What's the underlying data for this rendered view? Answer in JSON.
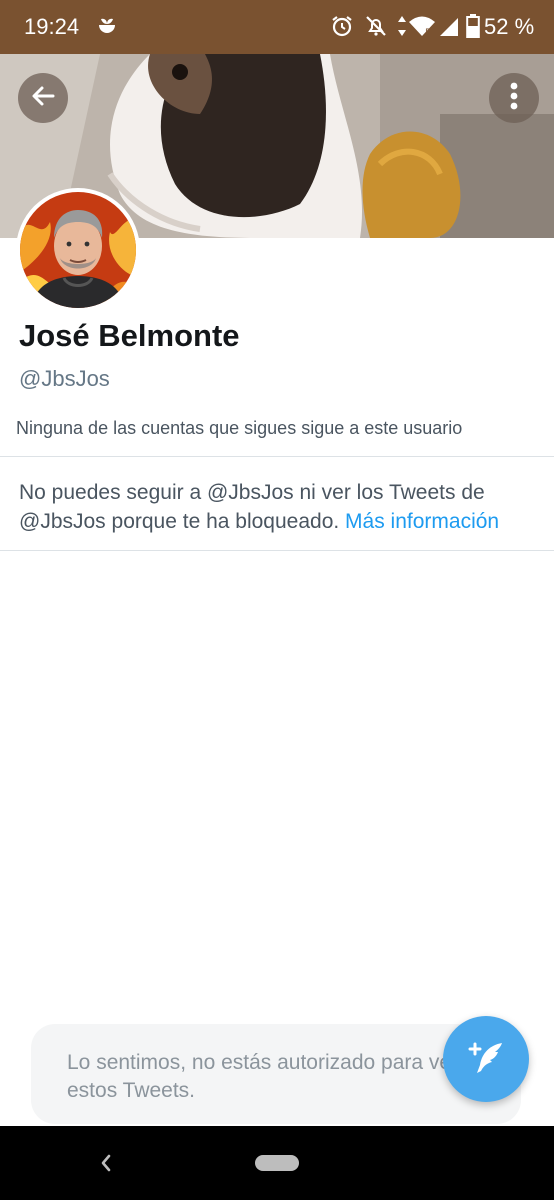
{
  "status_bar": {
    "time": "19:24",
    "battery_text": "52 %",
    "background_color": "#7a5230",
    "icons": [
      "app-notification-icon",
      "alarm-icon",
      "notifications-off-icon",
      "data-arrows-icon",
      "wifi-icon",
      "cell-signal-icon",
      "battery-icon"
    ]
  },
  "header": {
    "back_icon": "arrow-left-icon",
    "more_icon": "more-vertical-icon"
  },
  "profile": {
    "display_name": "José Belmonte",
    "handle": "@JbsJos",
    "followers_note": "Ninguna de las cuentas que sigues sigue a este usuario"
  },
  "blocked_notice": {
    "text": "No puedes seguir a @JbsJos ni ver los Tweets de @JbsJos porque te ha bloqueado. ",
    "link": "Más información",
    "link_color": "#1d9bf0"
  },
  "toast": {
    "message": "Lo sentimos, no estás autorizado para ver estos Tweets."
  },
  "fab": {
    "icon": "compose-tweet-icon",
    "color": "#4aa8ec"
  },
  "nav_bar": {
    "back_icon": "nav-back-icon",
    "home_icon": "nav-home-pill"
  }
}
